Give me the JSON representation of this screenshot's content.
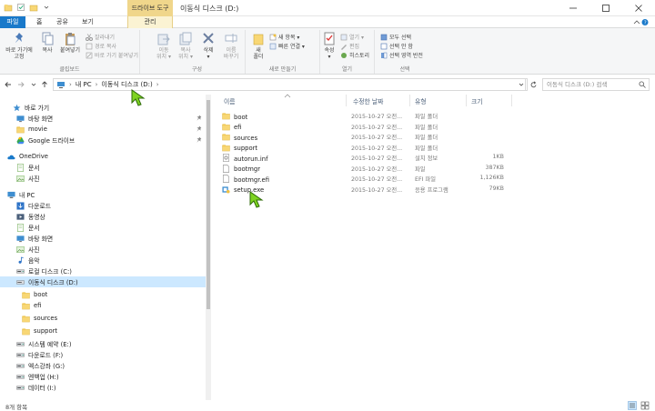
{
  "titlebar": {
    "context_tab": "드라이브 도구",
    "title": "이동식 디스크 (D:)"
  },
  "tabs": {
    "file": "파일",
    "home": "홈",
    "share": "공유",
    "view": "보기",
    "manage": "관리"
  },
  "ribbon": {
    "clipboard": {
      "pin": "바로 가기에\n고정",
      "copy": "복사",
      "paste": "붙여넣기",
      "cut": "잘라내기",
      "copy_path": "경로 복사",
      "paste_shortcut": "바로 가기 붙여넣기",
      "label": "클립보드"
    },
    "organize": {
      "move_to": "이동\n위치 ▾",
      "copy_to": "복사\n위치 ▾",
      "delete": "삭제\n▾",
      "rename": "이름\n바꾸기",
      "label": "구성"
    },
    "new": {
      "new_folder": "새\n폴더",
      "new_item": "새 항목 ▾",
      "easy_access": "빠른 연결 ▾",
      "label": "새로 만들기"
    },
    "open": {
      "properties": "속성\n▾",
      "open": "열기 ▾",
      "edit": "편집",
      "history": "히스토리",
      "label": "열기"
    },
    "select": {
      "select_all": "모두 선택",
      "select_none": "선택 안 함",
      "invert": "선택 영역 반전",
      "label": "선택"
    }
  },
  "address": {
    "crumb_pc": "내 PC",
    "crumb_drive": "이동식 디스크 (D:)",
    "search_placeholder": "이동식 디스크 (D:) 검색"
  },
  "nav": [
    {
      "label": "바로 가기",
      "icon": "star-icon"
    },
    {
      "label": "바탕 화면",
      "icon": "desktop-icon"
    },
    {
      "label": "movie",
      "icon": "folder-icon"
    },
    {
      "label": "Google 드라이브",
      "icon": "google-drive-icon"
    },
    {
      "label": "OneDrive",
      "icon": "onedrive-icon"
    },
    {
      "label": "문서",
      "icon": "documents-icon"
    },
    {
      "label": "사진",
      "icon": "pictures-icon"
    },
    {
      "label": "내 PC",
      "icon": "pc-icon"
    },
    {
      "label": "다운로드",
      "icon": "download-icon"
    },
    {
      "label": "동영상",
      "icon": "video-icon"
    },
    {
      "label": "문서",
      "icon": "documents-icon"
    },
    {
      "label": "바탕 화면",
      "icon": "desktop-icon"
    },
    {
      "label": "사진",
      "icon": "pictures-icon"
    },
    {
      "label": "음악",
      "icon": "music-icon"
    },
    {
      "label": "로컬 디스크 (C:)",
      "icon": "disk-icon"
    },
    {
      "label": "이동식 디스크 (D:)",
      "icon": "removable-drive-icon"
    },
    {
      "label": "boot",
      "icon": "folder-icon"
    },
    {
      "label": "efi",
      "icon": "folder-icon"
    },
    {
      "label": "sources",
      "icon": "folder-icon"
    },
    {
      "label": "support",
      "icon": "folder-icon"
    },
    {
      "label": "시스템 예약 (E:)",
      "icon": "disk-icon"
    },
    {
      "label": "다운로드 (F:)",
      "icon": "disk-icon"
    },
    {
      "label": "엑스강좌 (G:)",
      "icon": "disk-icon"
    },
    {
      "label": "엔백업 (H:)",
      "icon": "disk-icon"
    },
    {
      "label": "데이터 (I:)",
      "icon": "disk-icon"
    }
  ],
  "columns": {
    "name": "이름",
    "date": "수정한 날짜",
    "type": "유형",
    "size": "크기"
  },
  "files": [
    {
      "name": "boot",
      "date": "2015-10-27 오전...",
      "type": "파일 폴더",
      "size": "",
      "icon": "folder-icon"
    },
    {
      "name": "efi",
      "date": "2015-10-27 오전...",
      "type": "파일 폴더",
      "size": "",
      "icon": "folder-icon"
    },
    {
      "name": "sources",
      "date": "2015-10-27 오전...",
      "type": "파일 폴더",
      "size": "",
      "icon": "folder-icon"
    },
    {
      "name": "support",
      "date": "2015-10-27 오전...",
      "type": "파일 폴더",
      "size": "",
      "icon": "folder-icon"
    },
    {
      "name": "autorun.inf",
      "date": "2015-10-27 오전...",
      "type": "설치 정보",
      "size": "1KB",
      "icon": "settings-file-icon"
    },
    {
      "name": "bootmgr",
      "date": "2015-10-27 오전...",
      "type": "파일",
      "size": "387KB",
      "icon": "file-icon"
    },
    {
      "name": "bootmgr.efi",
      "date": "2015-10-27 오전...",
      "type": "EFI 파일",
      "size": "1,126KB",
      "icon": "file-icon"
    },
    {
      "name": "setup.exe",
      "date": "2015-10-27 오전...",
      "type": "응용 프로그램",
      "size": "79KB",
      "icon": "setup-exe-icon"
    }
  ],
  "status": {
    "count": "8개 항목"
  },
  "colors": {
    "accent": "#1979ca",
    "context": "#f0d68b",
    "selection": "#cce8ff",
    "folder": "#f8d775",
    "cursor": "#7ed321"
  }
}
